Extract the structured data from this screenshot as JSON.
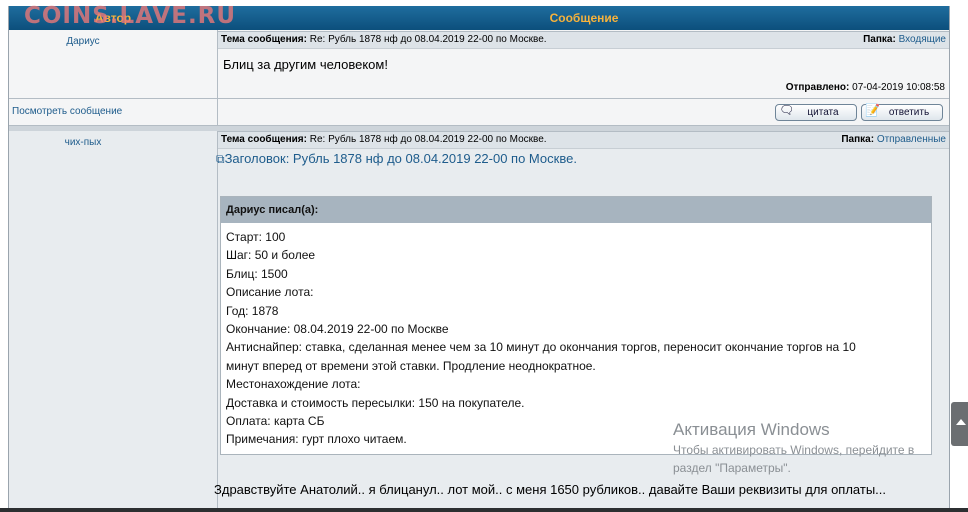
{
  "watermark_logo": "COINS.LAVE.RU",
  "header": {
    "author_col": "Автор",
    "message_col": "Сообщение"
  },
  "labels": {
    "subject": "Тема сообщения:",
    "folder": "Папка:",
    "sent": "Отправлено:",
    "view_message": "Посмотреть сообщение",
    "quote_btn": "цитата",
    "reply_btn": "ответить"
  },
  "messages": [
    {
      "author": "Дариус",
      "subject": "Re: Рубль 1878 нф до 08.04.2019 22-00 по Москве.",
      "folder": "Входящие",
      "text": "Блиц за другим человеком!",
      "sent": "07-04-2019 10:08:58"
    },
    {
      "author": "чих-пых",
      "subject": "Re: Рубль 1878 нф до 08.04.2019 22-00 по Москве.",
      "folder": "Отправленные",
      "topic": "Заголовок: Рубль 1878 нф до 08.04.2019 22-00 по Москве.",
      "quote_header": "Дариус писал(а):",
      "quote_lines": [
        "Старт: 100",
        "Шаг: 50 и более",
        "Блиц: 1500",
        "Описание лота:",
        "Год: 1878",
        "Окончание: 08.04.2019 22-00 по Москве",
        "Антиснайпер: ставка, сделанная менее чем за 10 минут до окончания торгов, переносит окончание торгов на 10",
        "минут вперед от времени этой ставки. Продление неоднократное.",
        "Местонахождение лота:",
        "Доставка и стоимость пересылки: 150 на покупателе.",
        "Оплата: карта СБ",
        "Примечания: гурт плохо читаем."
      ],
      "reply_text": "Здравствуйте Анатолий.. я блицанул.. лот мой.. с меня 1650 рубликов.. давайте Ваши реквизиты для оплаты..."
    }
  ],
  "windows_activation": {
    "title": "Активация Windows",
    "line1": "Чтобы активировать Windows, перейдите в",
    "line2": "раздел \"Параметры\"."
  }
}
